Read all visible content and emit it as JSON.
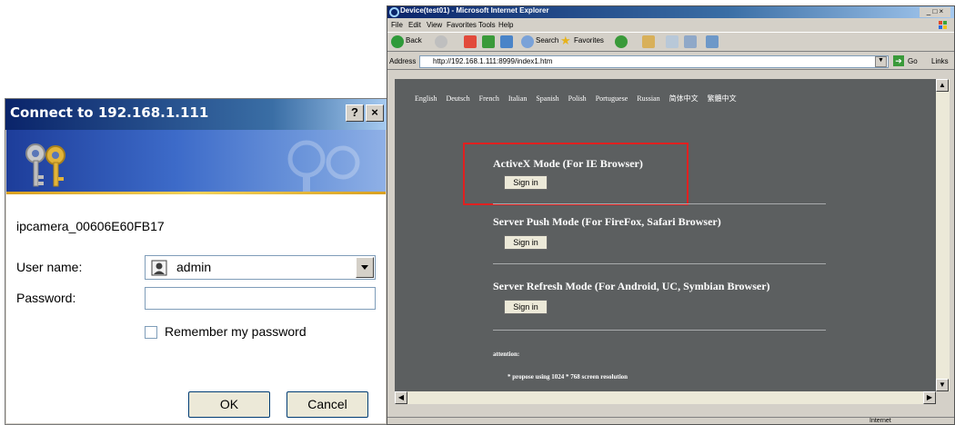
{
  "dialog": {
    "title": "Connect to 192.168.1.111",
    "help_btn": "?",
    "close_btn": "×",
    "realm": "ipcamera_00606E60FB17",
    "username_label": "User name:",
    "username_value": "admin",
    "password_label": "Password:",
    "password_value": "",
    "remember_label": "Remember my password",
    "remember_checked": false,
    "ok_label": "OK",
    "cancel_label": "Cancel"
  },
  "browser": {
    "title": "Device(test01) - Microsoft Internet Explorer",
    "menu": [
      "File",
      "Edit",
      "View",
      "Favorites",
      "Tools",
      "Help"
    ],
    "toolbar": {
      "back": "Back",
      "search": "Search",
      "favorites": "Favorites"
    },
    "address_label": "Address",
    "address": "http://192.168.1.111:8999/index1.htm",
    "go_label": "Go",
    "links_label": "Links",
    "status_zone": "Internet"
  },
  "page": {
    "languages": [
      "English",
      "Deutsch",
      "French",
      "Italian",
      "Spanish",
      "Polish",
      "Portuguese",
      "Russian",
      "简体中文",
      "繁體中文"
    ],
    "modes": [
      {
        "title": "ActiveX Mode (For IE Browser)",
        "button": "Sign in"
      },
      {
        "title": "Server Push Mode (For FireFox, Safari Browser)",
        "button": "Sign in"
      },
      {
        "title": "Server Refresh Mode (For Android, UC, Symbian Browser)",
        "button": "Sign in"
      }
    ],
    "attention_label": "attention:",
    "attention_text": "* propose using 1024 * 768 screen resolution",
    "highlight_color": "#e02020",
    "background_color": "#5c5f60"
  }
}
